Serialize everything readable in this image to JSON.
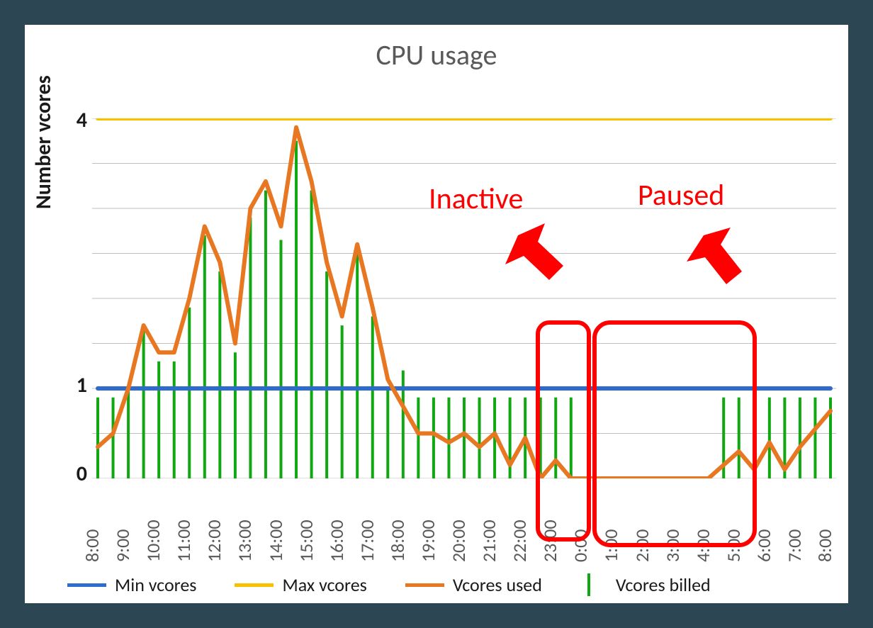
{
  "chart_data": {
    "type": "mixed",
    "title": "CPU usage",
    "ylabel": "Number vcores",
    "xlabel": "",
    "yticks": [
      0,
      1,
      4
    ],
    "ylim": [
      0,
      4
    ],
    "categories": [
      "8:00",
      "",
      "9:00",
      "",
      "10:00",
      "",
      "11:00",
      "",
      "12:00",
      "",
      "13:00",
      "",
      "14:00",
      "",
      "15:00",
      "",
      "16:00",
      "",
      "17:00",
      "",
      "18:00",
      "",
      "19:00",
      "",
      "20:00",
      "",
      "21:00",
      "",
      "22:00",
      "",
      "23:00",
      "",
      "0:00",
      "",
      "1:00",
      "",
      "2:00",
      "",
      "3:00",
      "",
      "4:00",
      "",
      "5:00",
      "",
      "6:00",
      "",
      "7:00",
      "",
      "8:00"
    ],
    "series": [
      {
        "name": "Min vcores",
        "type": "line",
        "color": "#2f6bcc",
        "values": [
          1,
          1,
          1,
          1,
          1,
          1,
          1,
          1,
          1,
          1,
          1,
          1,
          1,
          1,
          1,
          1,
          1,
          1,
          1,
          1,
          1,
          1,
          1,
          1,
          1,
          1,
          1,
          1,
          1,
          1,
          1,
          1,
          1,
          1,
          1,
          1,
          1,
          1,
          1,
          1,
          1,
          1,
          1,
          1,
          1,
          1,
          1,
          1,
          1
        ]
      },
      {
        "name": "Max vcores",
        "type": "line",
        "color": "#f7c100",
        "values": [
          4,
          4,
          4,
          4,
          4,
          4,
          4,
          4,
          4,
          4,
          4,
          4,
          4,
          4,
          4,
          4,
          4,
          4,
          4,
          4,
          4,
          4,
          4,
          4,
          4,
          4,
          4,
          4,
          4,
          4,
          4,
          4,
          4,
          4,
          4,
          4,
          4,
          4,
          4,
          4,
          4,
          4,
          4,
          4,
          4,
          4,
          4,
          4,
          4
        ]
      },
      {
        "name": "Vcores used",
        "type": "line",
        "color": "#e87722",
        "values": [
          0.35,
          0.5,
          1.0,
          1.7,
          1.4,
          1.4,
          2.0,
          2.8,
          2.4,
          1.5,
          3.0,
          3.3,
          2.8,
          3.9,
          3.3,
          2.4,
          1.8,
          2.6,
          1.9,
          1.1,
          0.8,
          0.5,
          0.5,
          0.4,
          0.5,
          0.35,
          0.5,
          0.15,
          0.45,
          0.0,
          0.2,
          0.0,
          0.0,
          0.0,
          0.0,
          0.0,
          0.0,
          0.0,
          0.0,
          0.0,
          0.0,
          0.15,
          0.3,
          0.1,
          0.4,
          0.1,
          0.35,
          0.55,
          0.75
        ]
      },
      {
        "name": "Vcores billed",
        "type": "bar",
        "color": "#10a810",
        "values": [
          0.9,
          0.9,
          1.0,
          1.7,
          1.3,
          1.3,
          1.9,
          2.7,
          2.3,
          1.4,
          2.9,
          3.2,
          2.65,
          3.75,
          3.2,
          2.3,
          1.7,
          2.5,
          1.8,
          1.0,
          1.2,
          0.9,
          0.9,
          0.9,
          0.9,
          0.9,
          0.9,
          0.9,
          0.9,
          0.9,
          0.9,
          0.9,
          null,
          null,
          null,
          null,
          null,
          null,
          null,
          null,
          null,
          0.9,
          0.9,
          0.9,
          0.9,
          0.9,
          0.9,
          0.9,
          0.9
        ]
      }
    ],
    "annotations": [
      {
        "label": "Inactive",
        "target_range": [
          "22:00",
          "23:00"
        ]
      },
      {
        "label": "Paused",
        "target_range": [
          "0:00",
          "4:00"
        ]
      }
    ],
    "legend": [
      "Min vcores",
      "Max vcores",
      "Vcores used",
      "Vcores billed"
    ]
  }
}
